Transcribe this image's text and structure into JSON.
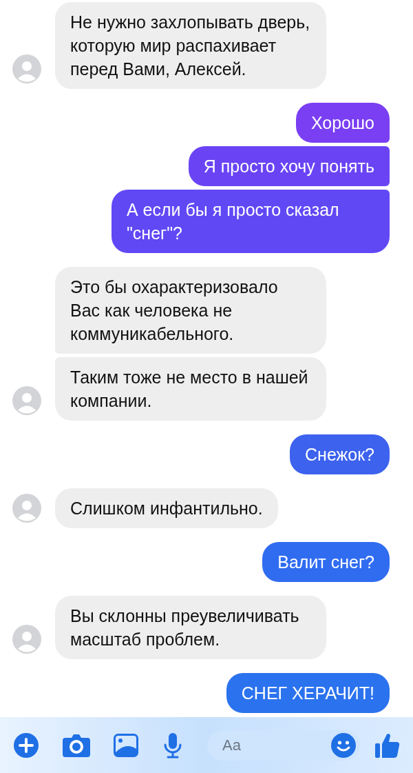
{
  "messages": [
    {
      "kind": "incoming",
      "text": "Не нужно захлопывать дверь, которую мир распахивает перед Вами, Алексей.",
      "avatar": true
    },
    {
      "kind": "outgoing",
      "text": "Хорошо",
      "color": "#7a3ff2"
    },
    {
      "kind": "outgoing",
      "text": "Я просто хочу понять",
      "color": "#6a44f4"
    },
    {
      "kind": "outgoing",
      "text": "А если бы я просто сказал \"снег\"?",
      "color": "#6148f5"
    },
    {
      "kind": "incoming",
      "text": "Это бы охарактеризовало Вас как человека не коммуникабельного.",
      "avatar": false
    },
    {
      "kind": "incoming",
      "text": "Таким тоже не место в нашей компании.",
      "avatar": true
    },
    {
      "kind": "outgoing",
      "text": "Снежок?",
      "color": "#3c62ee"
    },
    {
      "kind": "incoming",
      "text": "Слишком инфантильно.",
      "avatar": true
    },
    {
      "kind": "outgoing",
      "text": "Валит снег?",
      "color": "#306cf0"
    },
    {
      "kind": "incoming",
      "text": "Вы склонны преувеличивать масштаб проблем.",
      "avatar": true
    },
    {
      "kind": "outgoing",
      "text": "СНЕГ ХЕРАЧИТ!",
      "color": "#2b72ee"
    }
  ],
  "composer": {
    "placeholder": "Aa"
  }
}
